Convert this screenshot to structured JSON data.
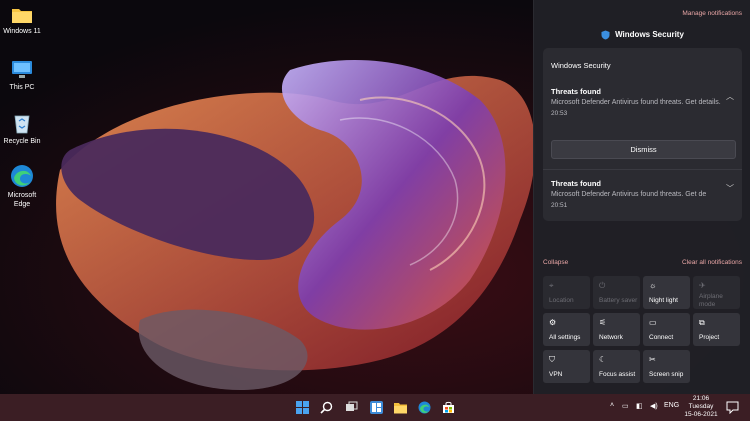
{
  "desktop": {
    "icons": [
      {
        "label": "Windows 11",
        "icon": "folder-icon"
      },
      {
        "label": "This PC",
        "icon": "monitor-icon"
      },
      {
        "label": "Recycle Bin",
        "icon": "recycle-bin-icon"
      },
      {
        "label": "Microsoft Edge",
        "icon": "edge-icon"
      }
    ]
  },
  "notifications": {
    "manage_label": "Manage notifications",
    "app_name": "Windows Security",
    "group_title": "Windows Security",
    "items": [
      {
        "title": "Threats found",
        "body": "Microsoft Defender Antivirus found threats. Get details.",
        "time": "20:53",
        "expanded": true
      },
      {
        "title": "Threats found",
        "body": "Microsoft Defender Antivirus found threats. Get de",
        "time": "20:51",
        "expanded": false
      }
    ],
    "dismiss_label": "Dismiss",
    "collapse_label": "Collapse",
    "clear_all_label": "Clear all notifications"
  },
  "quick_actions": [
    {
      "label": "Location",
      "icon": "location-icon",
      "enabled": false
    },
    {
      "label": "Battery saver",
      "icon": "battery-saver-icon",
      "enabled": false
    },
    {
      "label": "Night light",
      "icon": "night-light-icon",
      "enabled": true
    },
    {
      "label": "Airplane mode",
      "icon": "airplane-icon",
      "enabled": false
    },
    {
      "label": "All settings",
      "icon": "gear-icon",
      "enabled": true
    },
    {
      "label": "Network",
      "icon": "network-icon",
      "enabled": true
    },
    {
      "label": "Connect",
      "icon": "connect-icon",
      "enabled": true
    },
    {
      "label": "Project",
      "icon": "project-icon",
      "enabled": true
    },
    {
      "label": "VPN",
      "icon": "vpn-icon",
      "enabled": true
    },
    {
      "label": "Focus assist",
      "icon": "focus-assist-icon",
      "enabled": true
    },
    {
      "label": "Screen snip",
      "icon": "screen-snip-icon",
      "enabled": true
    }
  ],
  "taskbar": {
    "apps": [
      "start-icon",
      "search-icon",
      "task-view-icon",
      "widgets-icon",
      "file-explorer-icon",
      "edge-icon",
      "store-icon"
    ],
    "tray": {
      "language": "ENG",
      "time": "21:06",
      "day": "Tuesday",
      "date": "15-06-2021"
    }
  },
  "colors": {
    "accent": "#e8a6a6",
    "panel": "#202026",
    "taskbar": "#3b1e24"
  }
}
